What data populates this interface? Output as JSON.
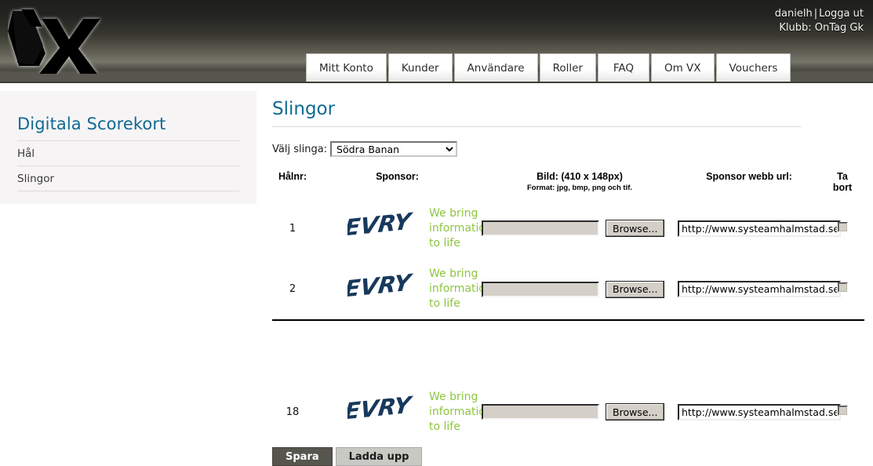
{
  "header": {
    "logo_text": "VX",
    "logo_icon": "vx-logo-icon",
    "user": "danielh",
    "separator": "|",
    "logout_label": "Logga ut",
    "club_label": "Klubb: OnTag Gk",
    "tabs": [
      {
        "label": "Mitt Konto"
      },
      {
        "label": "Kunder"
      },
      {
        "label": "Användare"
      },
      {
        "label": "Roller"
      },
      {
        "label": "FAQ"
      },
      {
        "label": "Om VX"
      },
      {
        "label": "Vouchers"
      }
    ]
  },
  "sidebar": {
    "title": "Digitala Scorekort",
    "items": [
      {
        "label": "Hål"
      },
      {
        "label": "Slingor"
      }
    ]
  },
  "main": {
    "page_title": "Slingor",
    "select": {
      "label": "Välj slinga:",
      "value": "Södra Banan",
      "options": [
        "Södra Banan"
      ]
    },
    "columns": {
      "num": "Hålnr:",
      "sponsor": "Sponsor:",
      "image": "Bild: (410 x 148px)",
      "image_sub": "Format: jpg, bmp, png och tif.",
      "url": "Sponsor webb url:",
      "delete_line1": "Ta",
      "delete_line2": "bort"
    },
    "sponsor_logo": {
      "name": "EVRY",
      "tagline_line1": "We bring",
      "tagline_line2": "information",
      "tagline_line3": "to life",
      "logo_color": "#17395c",
      "tagline_color": "#8dc63f"
    },
    "file_button_label": "Browse...",
    "file_input_value": "",
    "rows": [
      {
        "num": "1",
        "url": "http://www.systeamhalmstad.se",
        "deleted": false
      },
      {
        "num": "2",
        "url": "http://www.systeamhalmstad.se",
        "deleted": false
      },
      {
        "num": "18",
        "url": "http://www.systeamhalmstad.se",
        "deleted": false
      }
    ],
    "buttons": {
      "save": "Spara",
      "upload": "Ladda upp"
    }
  },
  "colors": {
    "accent_blue": "#0f6a93",
    "header_band": "#56564f",
    "sidebar_bg": "#f7f4f5",
    "sponsor_green": "#8dc63f"
  }
}
